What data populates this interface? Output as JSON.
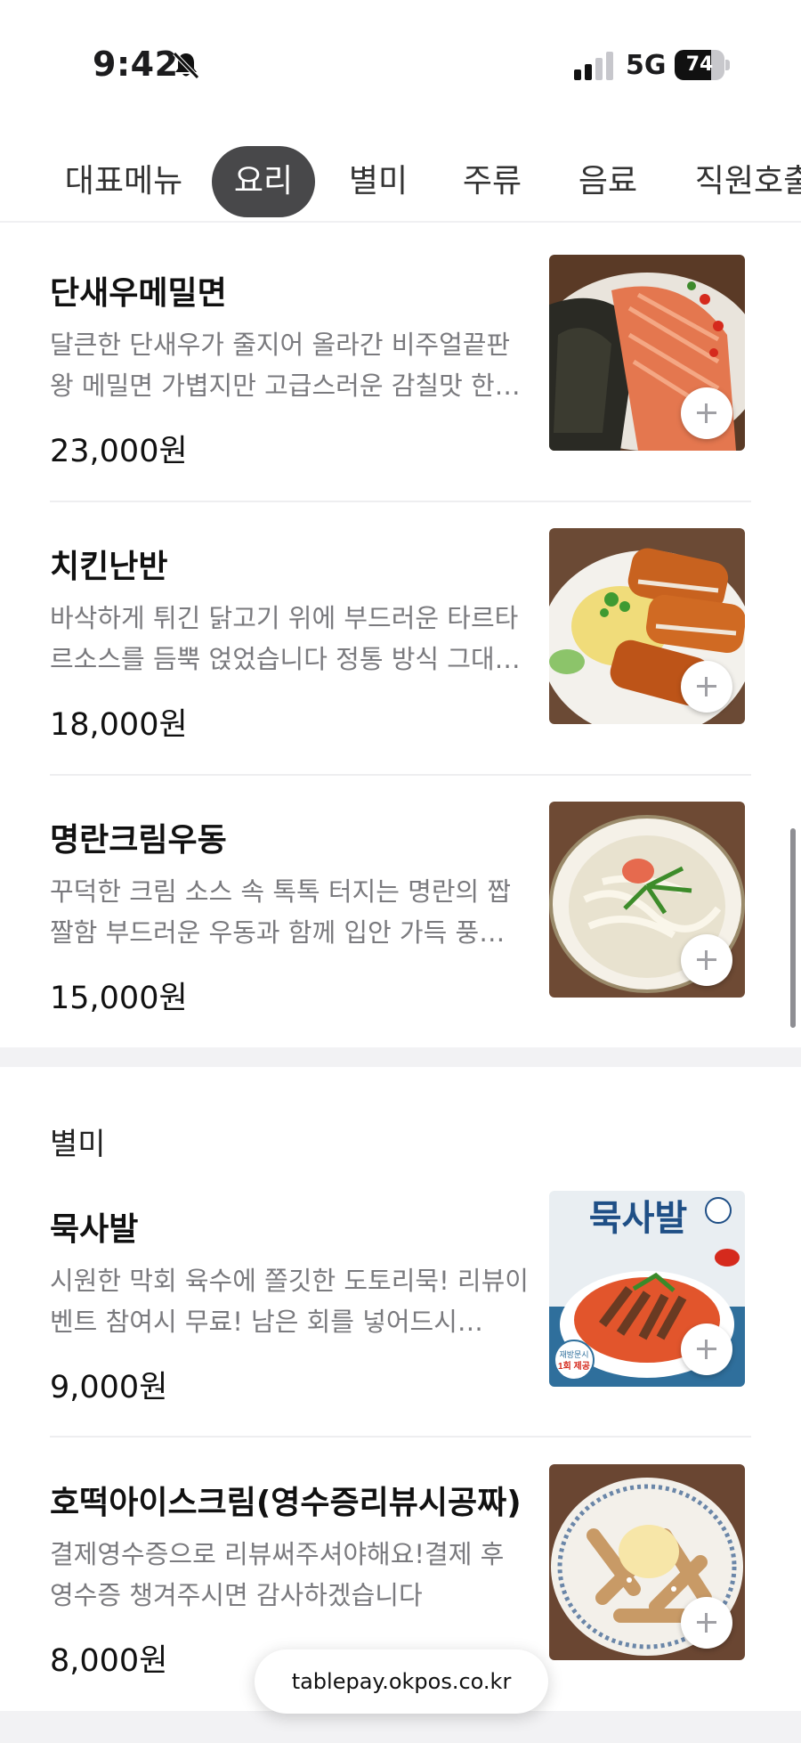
{
  "status_bar": {
    "time": "9:42",
    "network": "5G",
    "battery_level": "74",
    "battery_fraction": 0.74
  },
  "tabs": [
    {
      "label": "대표메뉴",
      "active": false
    },
    {
      "label": "요리",
      "active": true
    },
    {
      "label": "별미",
      "active": false
    },
    {
      "label": "주류",
      "active": false
    },
    {
      "label": "음료",
      "active": false
    },
    {
      "label": "직원호출",
      "active": false
    }
  ],
  "sections": [
    {
      "title": "",
      "items": [
        {
          "name": "단새우메밀면",
          "description": "달큰한 단새우가 줄지어 올라간 비주얼끝판왕 메밀면 가볍지만 고급스러운 감칠맛 한…",
          "price": "23,000원"
        },
        {
          "name": "치킨난반",
          "description": "바삭하게 튀긴 닭고기 위에 부드러운 타르타르소스를 듬뿍 얹었습니다 정통 방식 그대…",
          "price": "18,000원"
        },
        {
          "name": "명란크림우동",
          "description": "꾸덕한 크림 소스 속 톡톡 터지는 명란의 짭짤함 부드러운 우동과 함께 입안 가득 풍…",
          "price": "15,000원"
        }
      ]
    },
    {
      "title": "별미",
      "items": [
        {
          "name": "묵사발",
          "description": "시원한 막회 육수에 쫄깃한 도토리묵! 리뷰이벤트 참여시 무료! 남은 회를 넣어드시…",
          "price": "9,000원",
          "image_text": {
            "title": "묵사발",
            "badge_line1": "재방문시",
            "badge_line2": "1회 제공"
          }
        },
        {
          "name": "호떡아이스크림(영수증리뷰시공짜)",
          "description": "결제영수증으로 리뷰써주셔야해요!결제 후 영수증 챙겨주시면 감사하겠습니다",
          "price": "8,000원"
        }
      ]
    }
  ],
  "url_bar": {
    "text": "tablepay.okpos.co.kr"
  },
  "colors": {
    "active_tab": "#48484a",
    "price_text": "#111111",
    "desc_text": "#7a7a7e"
  }
}
